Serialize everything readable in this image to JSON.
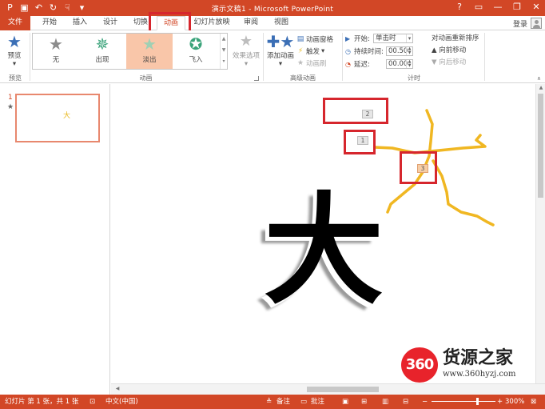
{
  "window": {
    "title": "演示文稿1 - Microsoft PowerPoint",
    "login": "登录",
    "qat_icons": [
      "save-icon",
      "undo-icon",
      "redo-icon",
      "touch-mode-icon",
      "customize-qat-icon"
    ],
    "controls": [
      "?",
      "▭",
      "—",
      "❐",
      "✕"
    ]
  },
  "tabs": [
    "文件",
    "开始",
    "插入",
    "设计",
    "切换",
    "动画",
    "幻灯片放映",
    "审阅",
    "视图"
  ],
  "ribbon": {
    "preview": {
      "label": "预览",
      "group": "预览"
    },
    "animations": {
      "group": "动画",
      "gallery": [
        {
          "label": "无",
          "color": "#8c8c8c"
        },
        {
          "label": "出现",
          "color": "#3aa37a"
        },
        {
          "label": "淡出",
          "color": "#9fd0b4"
        },
        {
          "label": "飞入",
          "color": "#3aa37a"
        }
      ],
      "effects_label": "效果选项"
    },
    "advanced": {
      "group": "高级动画",
      "add_label": "添加动画",
      "pane_label": "动画窗格",
      "trigger_label": "触发",
      "painter_label": "动画刷"
    },
    "timing": {
      "group": "计时",
      "start_label": "开始:",
      "start_value": "单击时",
      "duration_label": "持续时间:",
      "duration_value": "00.50",
      "delay_label": "延迟:",
      "delay_value": "00.00",
      "reorder_title": "对动画重新排序",
      "move_earlier": "向前移动",
      "move_later": "向后移动"
    }
  },
  "slides": [
    {
      "number": "1",
      "marker": "★",
      "glyph": "大"
    }
  ],
  "canvas": {
    "glyph": "大",
    "tags": [
      "1",
      "2",
      "3"
    ]
  },
  "status": {
    "slide_info": "幻灯片 第 1 张，共 1 张",
    "language": "中文(中国)",
    "notes": "备注",
    "comments": "批注",
    "zoom": "300%"
  },
  "watermark": {
    "logo": "360",
    "title": "货源之家",
    "url": "www.360hyzj.com"
  },
  "colors": {
    "accent": "#d24726",
    "highlight_box": "#d6262d",
    "stroke": "#f0b722"
  }
}
